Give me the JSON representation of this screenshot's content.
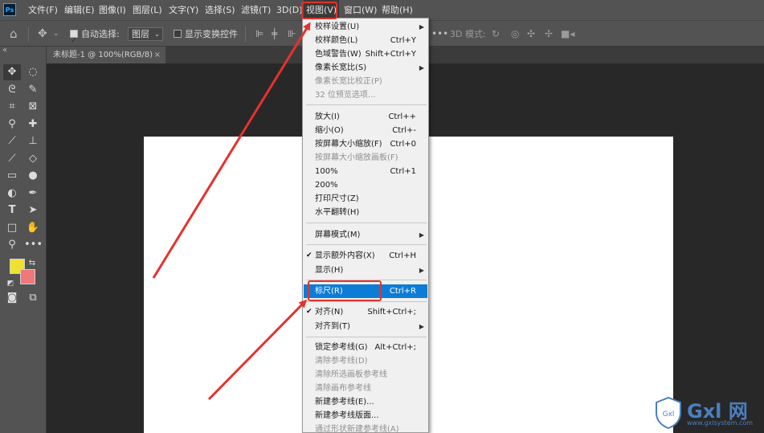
{
  "menubar": {
    "logo": "Ps",
    "items": [
      "文件(F)",
      "编辑(E)",
      "图像(I)",
      "图层(L)",
      "文字(Y)",
      "选择(S)",
      "滤镜(T)",
      "3D(D)",
      "视图(V)",
      "窗口(W)",
      "帮助(H)"
    ],
    "active": "视图(V)"
  },
  "options": {
    "auto_select_label": "自动选择:",
    "layer_dropdown": "图层",
    "show_transform_label": "显示变换控件",
    "mode_3d_label": "3D 模式:"
  },
  "document": {
    "tab_title": "未标题-1 @ 100%(RGB/8)",
    "close_glyph": "×"
  },
  "colors": {
    "foreground": "#f0e030",
    "background": "#f07878",
    "highlight": "#0d7cd6",
    "annotation": "#e5322d"
  },
  "view_menu": {
    "g1": [
      {
        "label": "校样设置(U)",
        "shortcut": "",
        "submenu": true,
        "disabled": false
      },
      {
        "label": "校样颜色(L)",
        "shortcut": "Ctrl+Y",
        "submenu": false,
        "disabled": false
      },
      {
        "label": "色域警告(W)",
        "shortcut": "Shift+Ctrl+Y",
        "submenu": false,
        "disabled": false
      },
      {
        "label": "像素长宽比(S)",
        "shortcut": "",
        "submenu": true,
        "disabled": false
      },
      {
        "label": "像素长宽比校正(P)",
        "shortcut": "",
        "submenu": false,
        "disabled": true
      },
      {
        "label": "32 位预览选项...",
        "shortcut": "",
        "submenu": false,
        "disabled": true
      }
    ],
    "g2": [
      {
        "label": "放大(I)",
        "shortcut": "Ctrl++",
        "submenu": false,
        "disabled": false
      },
      {
        "label": "缩小(O)",
        "shortcut": "Ctrl+-",
        "submenu": false,
        "disabled": false
      },
      {
        "label": "按屏幕大小缩放(F)",
        "shortcut": "Ctrl+0",
        "submenu": false,
        "disabled": false
      },
      {
        "label": "按屏幕大小缩放画板(F)",
        "shortcut": "",
        "submenu": false,
        "disabled": true
      },
      {
        "label": "100%",
        "shortcut": "Ctrl+1",
        "submenu": false,
        "disabled": false
      },
      {
        "label": "200%",
        "shortcut": "",
        "submenu": false,
        "disabled": false
      },
      {
        "label": "打印尺寸(Z)",
        "shortcut": "",
        "submenu": false,
        "disabled": false
      },
      {
        "label": "水平翻转(H)",
        "shortcut": "",
        "submenu": false,
        "disabled": false
      }
    ],
    "g3": [
      {
        "label": "屏幕模式(M)",
        "shortcut": "",
        "submenu": true,
        "disabled": false
      }
    ],
    "g4": [
      {
        "label": "显示额外内容(X)",
        "shortcut": "Ctrl+H",
        "submenu": false,
        "disabled": false,
        "checked": true
      },
      {
        "label": "显示(H)",
        "shortcut": "",
        "submenu": true,
        "disabled": false
      }
    ],
    "g5": [
      {
        "label": "标尺(R)",
        "shortcut": "Ctrl+R",
        "submenu": false,
        "disabled": false,
        "highlighted": true
      }
    ],
    "g6": [
      {
        "label": "对齐(N)",
        "shortcut": "Shift+Ctrl+;",
        "submenu": false,
        "disabled": false,
        "checked": true
      },
      {
        "label": "对齐到(T)",
        "shortcut": "",
        "submenu": true,
        "disabled": false
      }
    ],
    "g7": [
      {
        "label": "锁定参考线(G)",
        "shortcut": "Alt+Ctrl+;",
        "submenu": false,
        "disabled": false
      },
      {
        "label": "清除参考线(D)",
        "shortcut": "",
        "submenu": false,
        "disabled": true
      },
      {
        "label": "清除所选画板参考线",
        "shortcut": "",
        "submenu": false,
        "disabled": true
      },
      {
        "label": "清除画布参考线",
        "shortcut": "",
        "submenu": false,
        "disabled": true
      },
      {
        "label": "新建参考线(E)...",
        "shortcut": "",
        "submenu": false,
        "disabled": false
      },
      {
        "label": "新建参考线版面...",
        "shortcut": "",
        "submenu": false,
        "disabled": false
      },
      {
        "label": "通过形状新建参考线(A)",
        "shortcut": "",
        "submenu": false,
        "disabled": true
      }
    ]
  },
  "watermark": {
    "text": "Gxl 网",
    "url": "www.gxlsystem.com"
  }
}
